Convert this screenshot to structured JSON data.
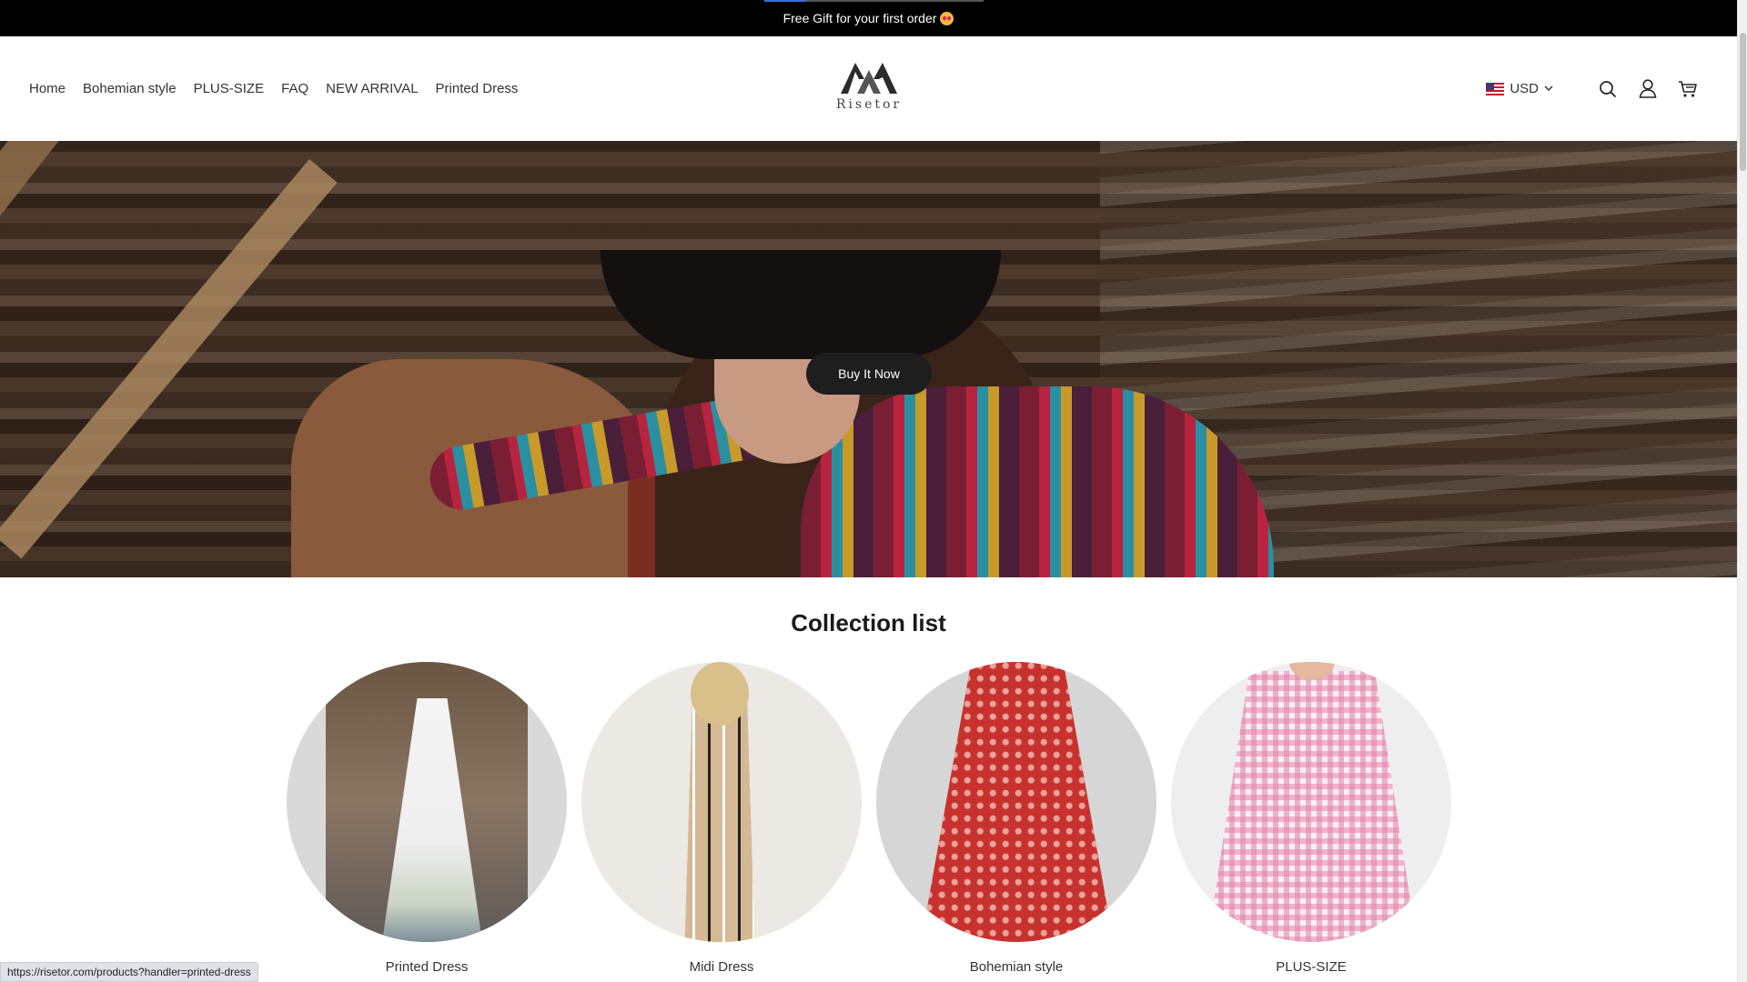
{
  "announcement": {
    "text": "Free Gift for your first order",
    "emoji": "star-struck-emoji",
    "slide_progress": 0.19
  },
  "header": {
    "nav": [
      {
        "label": "Home"
      },
      {
        "label": "Bohemian style"
      },
      {
        "label": "PLUS-SIZE"
      },
      {
        "label": "FAQ"
      },
      {
        "label": "NEW ARRIVAL"
      },
      {
        "label": "Printed Dress"
      }
    ],
    "logo_text": "Risetor",
    "currency": "USD",
    "icons": [
      "search-icon",
      "account-icon",
      "cart-icon"
    ]
  },
  "hero": {
    "button_label": "Buy It Now"
  },
  "collection": {
    "title": "Collection list",
    "items": [
      {
        "label": "Printed Dress"
      },
      {
        "label": "Midi Dress"
      },
      {
        "label": "Bohemian style"
      },
      {
        "label": "PLUS-SIZE"
      }
    ]
  },
  "status_bar": {
    "url": "https://risetor.com/products?handler=printed-dress"
  },
  "colors": {
    "announcement_bg": "#000000",
    "button_bg": "#1e1e1e",
    "text": "#333333"
  }
}
